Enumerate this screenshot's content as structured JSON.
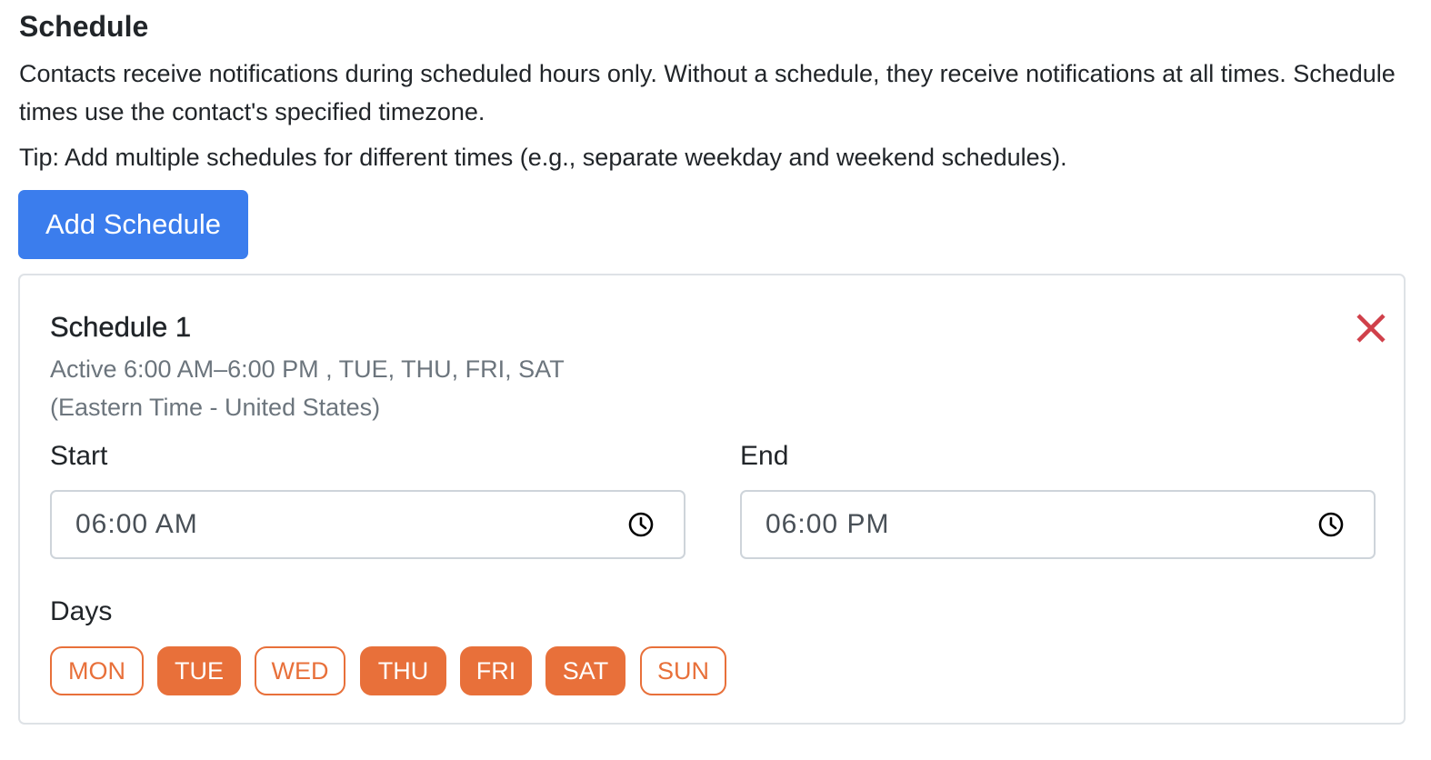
{
  "section": {
    "title": "Schedule",
    "description": "Contacts receive notifications during scheduled hours only. Without a schedule, they receive notifications at all times. Schedule times use the contact's specified timezone.",
    "tip": "Tip: Add multiple schedules for different times (e.g., separate weekday and weekend schedules).",
    "add_button_label": "Add Schedule"
  },
  "schedule": {
    "title": "Schedule 1",
    "summary": "Active 6:00 AM–6:00 PM , TUE, THU, FRI, SAT",
    "timezone": "(Eastern Time - United States)",
    "start": {
      "label": "Start",
      "hour": "06",
      "minute": "00",
      "period": "AM"
    },
    "end": {
      "label": "End",
      "hour": "06",
      "minute": "00",
      "period": "PM"
    },
    "days_label": "Days",
    "days": [
      {
        "label": "MON",
        "selected": false
      },
      {
        "label": "TUE",
        "selected": true
      },
      {
        "label": "WED",
        "selected": false
      },
      {
        "label": "THU",
        "selected": true
      },
      {
        "label": "FRI",
        "selected": true
      },
      {
        "label": "SAT",
        "selected": true
      },
      {
        "label": "SUN",
        "selected": false
      }
    ]
  },
  "icons": {
    "close": "close-icon",
    "clock": "clock-icon"
  },
  "colors": {
    "primary": "#3b7ded",
    "accent": "#e8703a",
    "danger": "#d0404a",
    "muted": "#6c757d",
    "border": "#dee2e6"
  }
}
